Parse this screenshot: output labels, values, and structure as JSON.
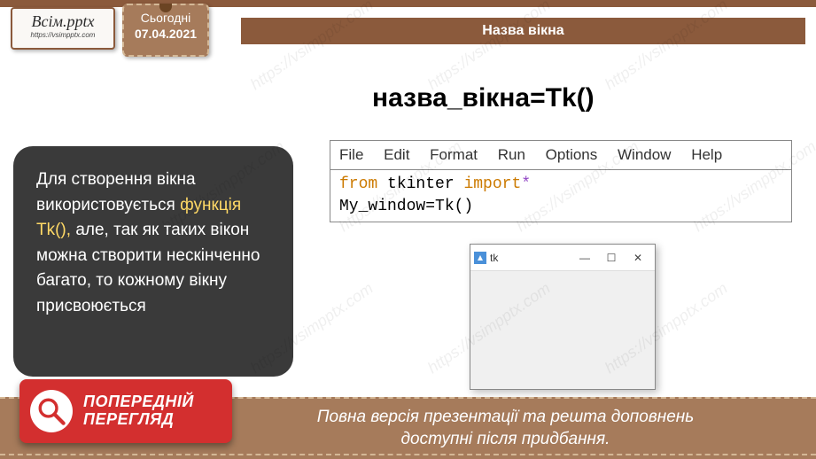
{
  "logo": {
    "title": "Всім.pptx",
    "url": "https://vsimpptx.com"
  },
  "date": {
    "today": "Сьогодні",
    "value": "07.04.2021"
  },
  "title_bar": "Назва вікна",
  "formula": "назва_вікна=Tk()",
  "code": {
    "menu": {
      "file": "File",
      "edit": "Edit",
      "format": "Format",
      "run": "Run",
      "options": "Options",
      "window": "Window",
      "help": "Help"
    },
    "kw_from": "from",
    "mod": " tkinter ",
    "kw_import": "import",
    "star": "*",
    "line2": "My_window=Tk()"
  },
  "textbox": {
    "t1": "   Для створення вікна використовується ",
    "hl": "функція Tk(),",
    "t2": " але, так як таких вікон можна створити нескінченно багато, то кожному вікну присвоюється"
  },
  "tk": {
    "name": "tk",
    "min": "—",
    "max": "☐",
    "close": "✕"
  },
  "preview": {
    "line1": "ПОПЕРЕДНІЙ",
    "line2": "ПЕРЕГЛЯД"
  },
  "footer": {
    "line1": "Повна версія презентації та решта доповнень",
    "line2": "доступні після придбання."
  },
  "watermark": "https://vsimpptx.com"
}
